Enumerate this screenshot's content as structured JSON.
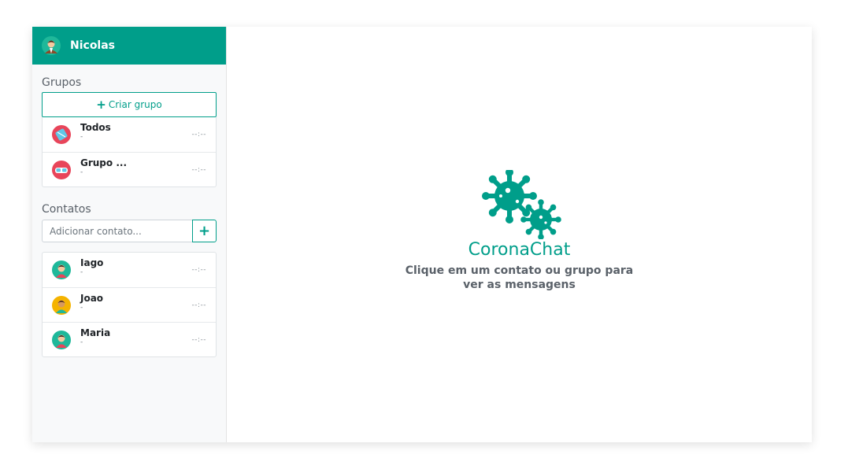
{
  "user": {
    "name": "Nicolas",
    "avatar_icon": "user-avatar-icon"
  },
  "groups": {
    "title": "Grupos",
    "create_label": "Criar grupo",
    "items": [
      {
        "name": "Todos",
        "preview": "-",
        "time": "--:--"
      },
      {
        "name": "Grupo ...",
        "preview": "-",
        "time": "--:--"
      }
    ]
  },
  "contacts": {
    "title": "Contatos",
    "add_placeholder": "Adicionar contato...",
    "add_button": "+",
    "items": [
      {
        "name": "Iago",
        "preview": "-",
        "time": "--:--"
      },
      {
        "name": "Joao",
        "preview": "-",
        "time": "--:--"
      },
      {
        "name": "Maria",
        "preview": "-",
        "time": "--:--"
      }
    ]
  },
  "main": {
    "brand": "CoronaChat",
    "hint": "Clique em um contato ou grupo para ver as mensagens"
  },
  "colors": {
    "accent": "#009e8a"
  }
}
